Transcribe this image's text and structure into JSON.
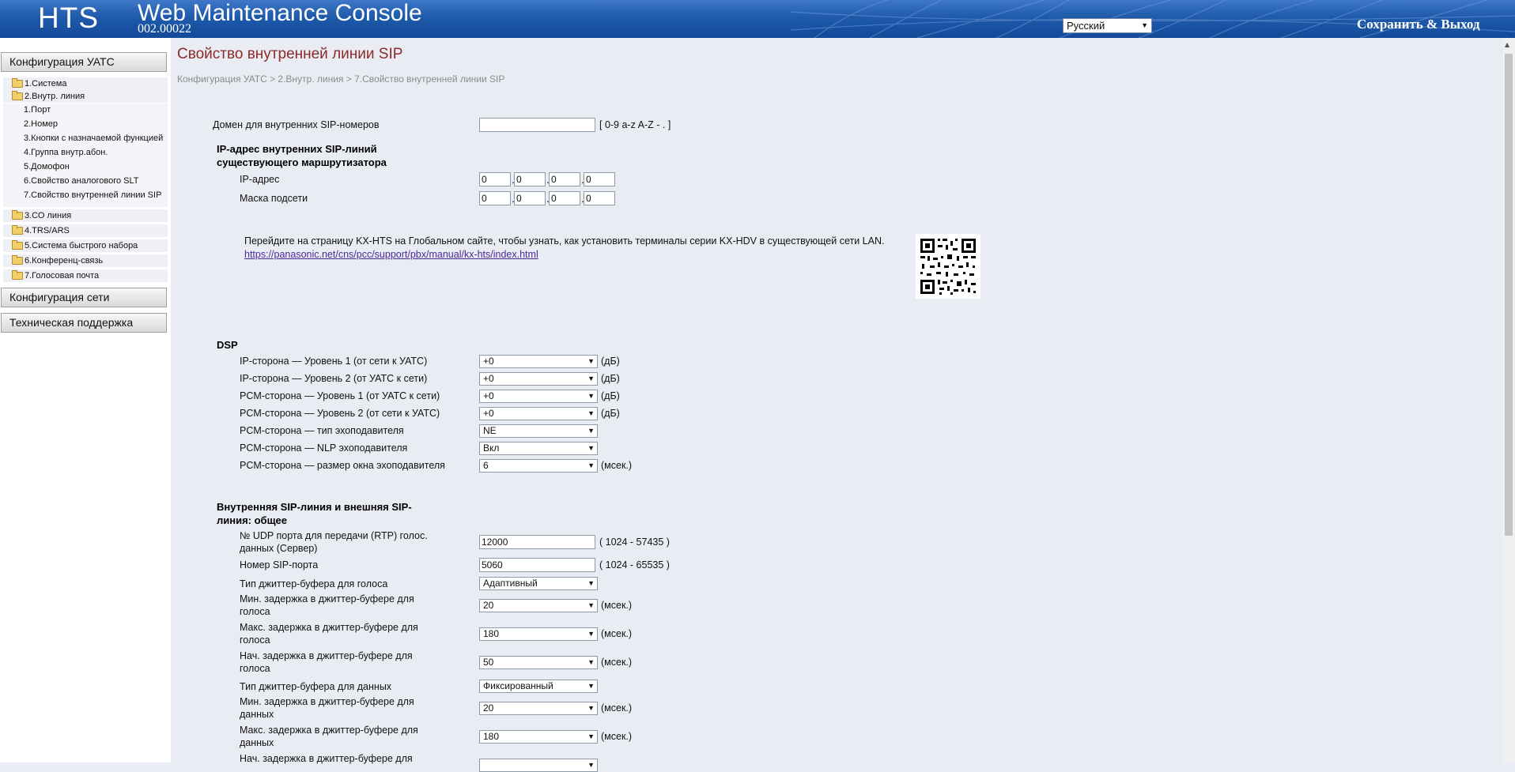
{
  "header": {
    "logo": "HTS",
    "title": "Web Maintenance Console",
    "version": "002.00022",
    "language": "Русский",
    "save_exit": "Сохранить & Выход"
  },
  "sidebar": {
    "config_pbx": "Конфигурация УАТС",
    "tree_top": [
      {
        "label": "1.Система"
      },
      {
        "label": "2.Внутр. линия"
      }
    ],
    "sub_items": [
      {
        "label": "1.Порт"
      },
      {
        "label": "2.Номер"
      },
      {
        "label": "3.Кнопки с назначаемой функцией"
      },
      {
        "label": "4.Группа внутр.абон."
      },
      {
        "label": "5.Домофон"
      },
      {
        "label": "6.Свойство аналогового SLT"
      },
      {
        "label": "7.Свойство внутренней линии SIP"
      }
    ],
    "tree_bottom": [
      {
        "label": "3.СО линия"
      },
      {
        "label": "4.TRS/ARS"
      },
      {
        "label": "5.Система быстрого набора"
      },
      {
        "label": "6.Конференц-связь"
      },
      {
        "label": "7.Голосовая почта"
      }
    ],
    "config_network": "Конфигурация сети",
    "tech_support": "Техническая поддержка"
  },
  "main": {
    "title": "Свойство внутренней линии SIP",
    "breadcrumb": "Конфигурация УАТС > 2.Внутр. линия > 7.Свойство внутренней линии SIP",
    "domain": {
      "label": "Домен для внутренних SIP-номеров",
      "value": "",
      "hint": "[ 0-9 a-z A-Z - . ]"
    },
    "ip_section": {
      "title_line1": "IP-адрес внутренних SIP-линий",
      "title_line2": "существующего маршрутизатора",
      "ip_label": "IP-адрес",
      "ip": [
        "0",
        "0",
        "0",
        "0"
      ],
      "mask_label": "Маска подсети",
      "mask": [
        "0",
        "0",
        "0",
        "0"
      ]
    },
    "note": {
      "text": "Перейдите на страницу KX-HTS на Глобальном сайте, чтобы узнать, как установить терминалы серии KX-HDV в существующей сети LAN.",
      "link": "https://panasonic.net/cns/pcc/support/pbx/manual/kx-hts/index.html"
    },
    "dsp": {
      "title": "DSP",
      "rows": [
        {
          "label": "IP-сторона — Уровень 1 (от сети к УАТС)",
          "value": "+0",
          "unit": "(дБ)"
        },
        {
          "label": "IP-сторона — Уровень 2 (от УАТС к сети)",
          "value": "+0",
          "unit": "(дБ)"
        },
        {
          "label": "PCM-сторона — Уровень 1 (от УАТС к сети)",
          "value": "+0",
          "unit": "(дБ)"
        },
        {
          "label": "PCM-сторона — Уровень 2 (от сети к УАТС)",
          "value": "+0",
          "unit": "(дБ)"
        },
        {
          "label": "PCM-сторона — тип эхоподавителя",
          "value": "NE",
          "unit": ""
        },
        {
          "label": "PCM-сторона — NLP эхоподавителя",
          "value": "Вкл",
          "unit": ""
        },
        {
          "label": "PCM-сторона — размер окна эхоподавителя",
          "value": "6",
          "unit": "(мсек.)"
        }
      ]
    },
    "general": {
      "title_line1": "Внутренняя SIP-линия и внешняя SIP-",
      "title_line2": "линия: общее",
      "rtp_label_1": "№ UDP порта для передачи (RTP) голос.",
      "rtp_label_2": "данных (Сервер)",
      "rtp_value": "12000",
      "rtp_range": "( 1024 - 57435 )",
      "sip_port_label": "Номер SIP-порта",
      "sip_port_value": "5060",
      "sip_port_range": "( 1024 - 65535 )",
      "jb_voice_type_label": "Тип джиттер-буфера для голоса",
      "jb_voice_type_value": "Адаптивный",
      "min_voice_label_1": "Мин. задержка в джиттер-буфере для",
      "min_voice_label_2": "голоса",
      "min_voice_value": "20",
      "max_voice_label_1": "Макс. задержка в джиттер-буфере для",
      "max_voice_label_2": "голоса",
      "max_voice_value": "180",
      "init_voice_label_1": "Нач. задержка в джиттер-буфере для",
      "init_voice_label_2": "голоса",
      "init_voice_value": "50",
      "jb_data_type_label": "Тип джиттер-буфера для данных",
      "jb_data_type_value": "Фиксированный",
      "min_data_label_1": "Мин. задержка в джиттер-буфере для",
      "min_data_label_2": "данных",
      "min_data_value": "20",
      "max_data_label_1": "Макс. задержка в джиттер-буфере для",
      "max_data_label_2": "данных",
      "max_data_value": "180",
      "init_data_label_1": "Нач. задержка в джиттер-буфере для",
      "ms_unit": "(мсек.)"
    }
  }
}
